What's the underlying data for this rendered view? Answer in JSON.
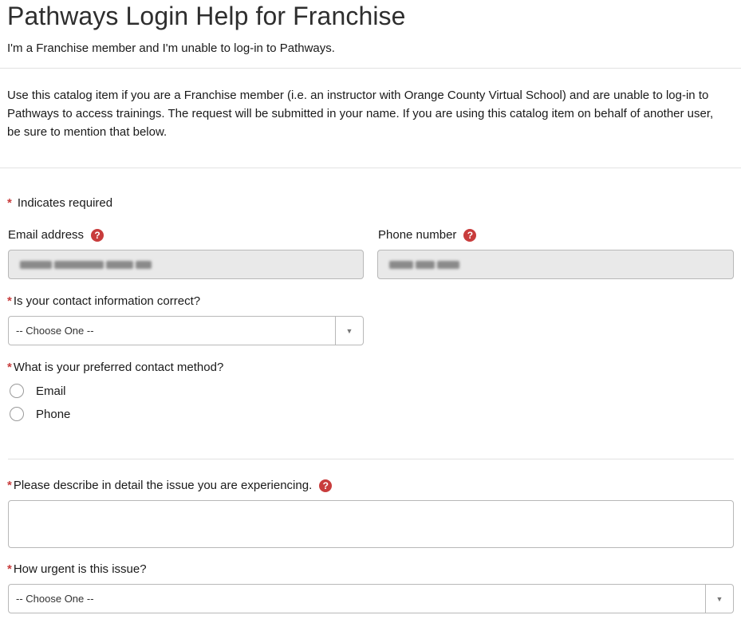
{
  "header": {
    "title": "Pathways Login Help for Franchise",
    "subtitle": "I'm a Franchise member and I'm unable to log-in to Pathways."
  },
  "description": "Use this catalog item if you are a Franchise member (i.e. an instructor with Orange County Virtual School) and are unable to log-in to Pathways to access trainings.  The request will be submitted in your name.  If you are using this catalog item on behalf of another user, be sure to mention that below.",
  "form": {
    "required_marker": "*",
    "required_note": "Indicates required",
    "email": {
      "label": "Email address",
      "value_obscured": true
    },
    "phone": {
      "label": "Phone number",
      "value_obscured": true
    },
    "contact_correct": {
      "label": "Is your contact information correct?",
      "selected": "-- Choose One --"
    },
    "preferred_contact": {
      "label": "What is your preferred contact method?",
      "options": [
        "Email",
        "Phone"
      ],
      "selected": null
    },
    "issue_description": {
      "label": "Please describe in detail the issue you are experiencing.",
      "value": ""
    },
    "urgency": {
      "label": "How urgent is this issue?",
      "selected": "-- Choose One --"
    }
  },
  "icons": {
    "help": "help-circle-icon",
    "dropdown": "caret-down-icon",
    "help_glyph": "?",
    "caret_glyph": "▼"
  },
  "colors": {
    "required": "#c83c3c",
    "help_icon": "#c83c3c",
    "readonly_field": "#e9e9e9",
    "border": "#b8b8b8"
  }
}
